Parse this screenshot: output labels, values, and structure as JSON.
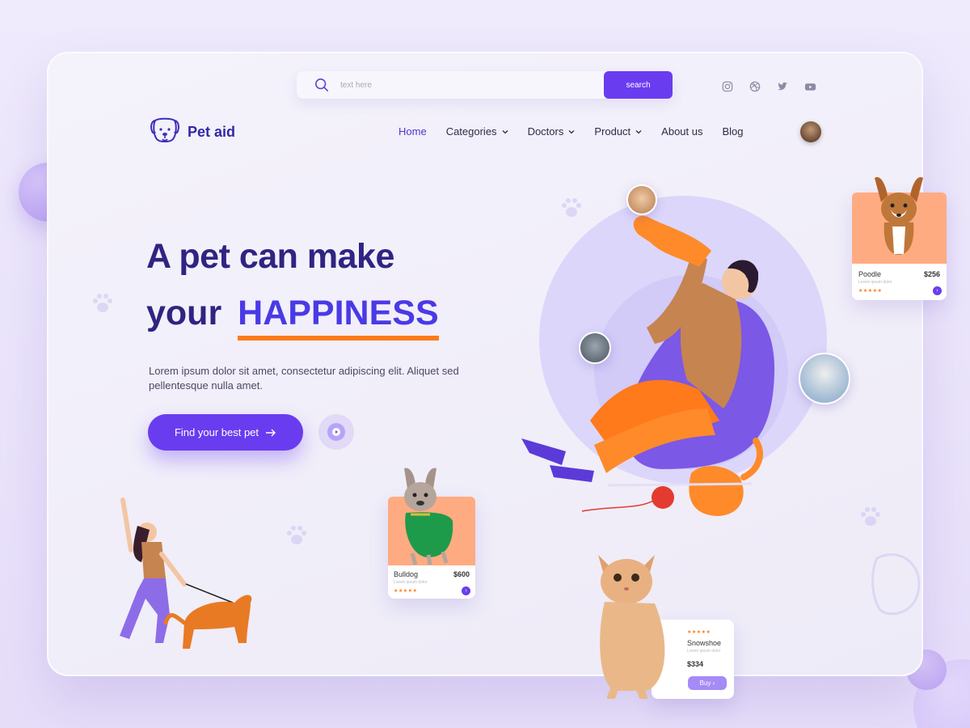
{
  "search": {
    "placeholder": "text here",
    "button_label": "search"
  },
  "socials": [
    "instagram-icon",
    "dribbble-icon",
    "twitter-icon",
    "youtube-icon"
  ],
  "brand": {
    "name": "Pet aid"
  },
  "nav": {
    "items": [
      {
        "label": "Home",
        "active": true,
        "dropdown": false
      },
      {
        "label": "Categories",
        "active": false,
        "dropdown": true
      },
      {
        "label": "Doctors",
        "active": false,
        "dropdown": true
      },
      {
        "label": "Product",
        "active": false,
        "dropdown": true
      },
      {
        "label": "About us",
        "active": false,
        "dropdown": false
      },
      {
        "label": "Blog",
        "active": false,
        "dropdown": false
      }
    ]
  },
  "hero": {
    "line1": "A pet can make",
    "line2_prefix": "your",
    "line2_highlight": "HAPPINESS",
    "description": "Lorem ipsum dolor sit amet, consectetur adipiscing elit. Aliquet sed pellentesque nulla amet.",
    "cta_label": "Find your best pet"
  },
  "cards": {
    "poodle": {
      "name": "Poodle",
      "price": "$256",
      "sub": "Lorem ipsum dolor",
      "rating": 5
    },
    "bulldog": {
      "name": "Bulldog",
      "price": "$600",
      "sub": "Lorem ipsum dolor",
      "rating": 5
    },
    "snowshoe": {
      "name": "Snowshoe",
      "price": "$334",
      "sub": "Lorem ipsum dolor",
      "rating": 5,
      "buy_label": "Buy"
    }
  },
  "colors": {
    "primary": "#6a3cf0",
    "heading": "#2f2482",
    "accent": "#ff7a1a",
    "card_photo_bg": "#ffab82"
  }
}
